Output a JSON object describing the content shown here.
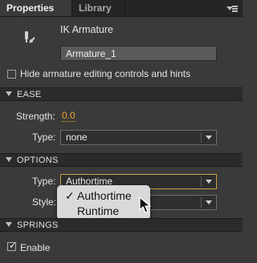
{
  "tabs": [
    {
      "label": "Properties",
      "active": true
    },
    {
      "label": "Library",
      "active": false
    }
  ],
  "header": {
    "icon": "armature-bone-icon",
    "type_label": "IK Armature",
    "name_value": "Armature_1"
  },
  "hide_controls": {
    "label": "Hide armature editing controls and hints",
    "checked": false
  },
  "ease": {
    "title": "EASE",
    "strength_label": "Strength:",
    "strength_value": "0.0",
    "type_label": "Type:",
    "type_value": "none"
  },
  "options": {
    "title": "OPTIONS",
    "type_label": "Type:",
    "type_value": "Authortime",
    "style_label": "Style:"
  },
  "dropdown": {
    "items": [
      {
        "label": "Authortime",
        "selected": true
      },
      {
        "label": "Runtime",
        "selected": false
      }
    ],
    "check_glyph": "✓"
  },
  "springs": {
    "title": "SPRINGS",
    "enable_label": "Enable",
    "enable_checked": true
  },
  "colors": {
    "accent_value": "#e8a52c",
    "focus_border": "#c8a24a",
    "panel_bg": "#3a3a3a",
    "section_bg": "#2b2b2b"
  }
}
